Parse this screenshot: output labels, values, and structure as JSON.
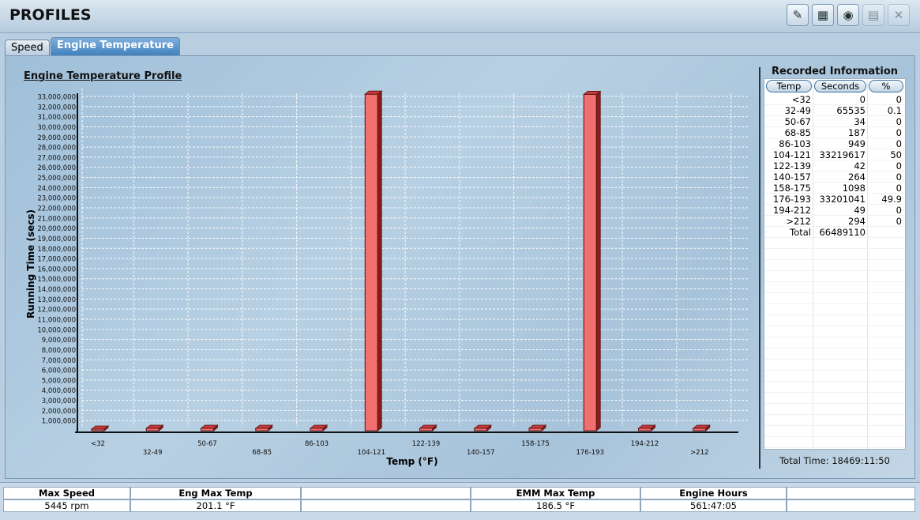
{
  "app": {
    "title": "PROFILES",
    "toolbar": [
      {
        "name": "clear-button",
        "icon": "broom-icon",
        "glyph": "✎",
        "enabled": true
      },
      {
        "name": "calculator-button",
        "icon": "calculator-icon",
        "glyph": "▦",
        "enabled": true
      },
      {
        "name": "camera-button",
        "icon": "camera-icon",
        "glyph": "◉",
        "enabled": true
      },
      {
        "name": "save-button",
        "icon": "save-icon",
        "glyph": "▤",
        "enabled": false
      },
      {
        "name": "close-button",
        "icon": "close-icon",
        "glyph": "✕",
        "enabled": false
      }
    ]
  },
  "tabs": [
    {
      "label": "Speed",
      "active": false
    },
    {
      "label": "Engine Temperature",
      "active": true
    }
  ],
  "chart": {
    "title": "Engine Temperature Profile",
    "bar_color": "#f07070",
    "bar_dark": "#8a1c1c"
  },
  "chart_data": {
    "type": "bar",
    "title": "Engine Temperature Profile",
    "xlabel": "Temp (°F)",
    "ylabel": "Running Time (secs)",
    "categories": [
      "<32",
      "32-49",
      "50-67",
      "68-85",
      "86-103",
      "104-121",
      "122-139",
      "140-157",
      "158-175",
      "176-193",
      "194-212",
      ">212"
    ],
    "values": [
      0,
      65535,
      34,
      187,
      949,
      33219617,
      42,
      264,
      1098,
      33201041,
      49,
      294
    ],
    "ylim": [
      0,
      33000000
    ],
    "yticks": [
      "1,000,000",
      "2,000,000",
      "3,000,000",
      "4,000,000",
      "5,000,000",
      "6,000,000",
      "7,000,000",
      "8,000,000",
      "9,000,000",
      "10,000,000",
      "11,000,000",
      "12,000,000",
      "13,000,000",
      "14,000,000",
      "15,000,000",
      "16,000,000",
      "17,000,000",
      "18,000,000",
      "19,000,000",
      "20,000,000",
      "21,000,000",
      "22,000,000",
      "23,000,000",
      "24,000,000",
      "25,000,000",
      "26,000,000",
      "27,000,000",
      "28,000,000",
      "29,000,000",
      "30,000,000",
      "31,000,000",
      "32,000,000",
      "33,000,000"
    ],
    "grid": true
  },
  "recorded": {
    "title": "Recorded Information",
    "headers": [
      "Temp",
      "Seconds",
      "%"
    ],
    "rows": [
      [
        "<32",
        "0",
        "0"
      ],
      [
        "32-49",
        "65535",
        "0.1"
      ],
      [
        "50-67",
        "34",
        "0"
      ],
      [
        "68-85",
        "187",
        "0"
      ],
      [
        "86-103",
        "949",
        "0"
      ],
      [
        "104-121",
        "33219617",
        "50"
      ],
      [
        "122-139",
        "42",
        "0"
      ],
      [
        "140-157",
        "264",
        "0"
      ],
      [
        "158-175",
        "1098",
        "0"
      ],
      [
        "176-193",
        "33201041",
        "49.9"
      ],
      [
        "194-212",
        "49",
        "0"
      ],
      [
        ">212",
        "294",
        "0"
      ],
      [
        "Total",
        "66489110",
        ""
      ]
    ],
    "total_time": "Total Time: 18469:11:50"
  },
  "footer": [
    {
      "label": "Max Speed",
      "value": "5445 rpm"
    },
    {
      "label": "Eng Max Temp",
      "value": "201.1 °F"
    },
    {
      "label": "",
      "value": ""
    },
    {
      "label": "EMM Max Temp",
      "value": "186.5 °F"
    },
    {
      "label": "Engine Hours",
      "value": "561:47:05"
    },
    {
      "label": "",
      "value": ""
    }
  ]
}
